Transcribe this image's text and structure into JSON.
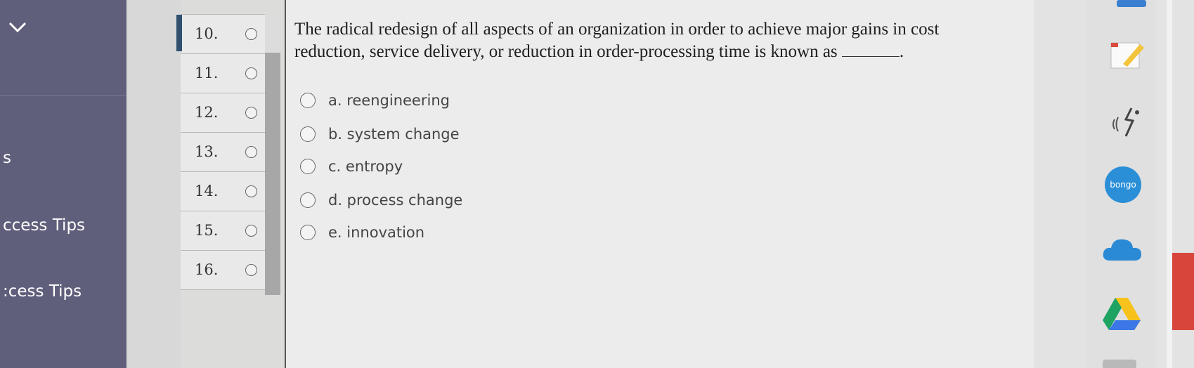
{
  "sidebar": {
    "items": [
      {
        "label": "s"
      },
      {
        "label": "ccess Tips"
      },
      {
        "label": ":cess Tips"
      }
    ]
  },
  "question_nav": {
    "items": [
      {
        "num": "10.",
        "active": true
      },
      {
        "num": "11."
      },
      {
        "num": "12."
      },
      {
        "num": "13."
      },
      {
        "num": "14."
      },
      {
        "num": "15."
      },
      {
        "num": "16."
      }
    ]
  },
  "question": {
    "text": "The radical redesign of all aspects of an organization in order to achieve major gains in cost reduction, service delivery, or reduction in order-processing time is known as",
    "end": "."
  },
  "options": [
    {
      "label": "a. reengineering"
    },
    {
      "label": "b. system change"
    },
    {
      "label": "c. entropy"
    },
    {
      "label": "d. process change"
    },
    {
      "label": "e. innovation"
    }
  ],
  "right_icons": {
    "bongo_label": "bongo"
  },
  "colors": {
    "sidebar": "#5f5f7c",
    "active_marker": "#30506e",
    "bongo": "#2b8fd8",
    "drive_green": "#1ea362",
    "drive_yellow": "#f7c21b",
    "drive_blue": "#3b77e7"
  }
}
